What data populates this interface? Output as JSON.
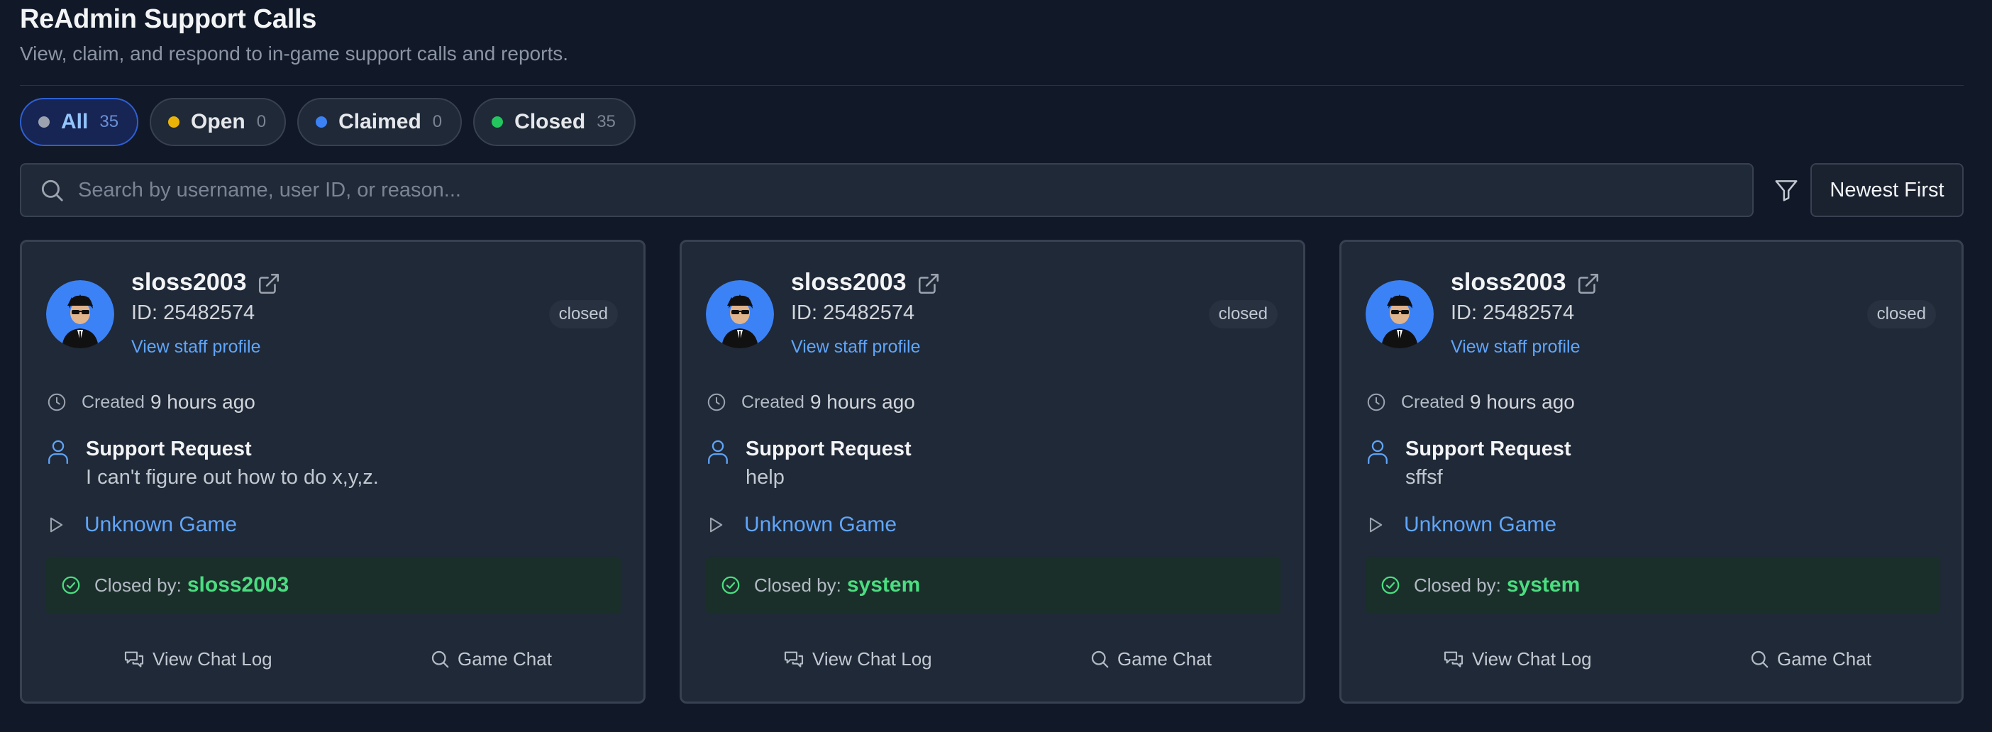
{
  "header": {
    "title": "ReAdmin Support Calls",
    "subtitle": "View, claim, and respond to in-game support calls and reports."
  },
  "tabs": [
    {
      "label": "All",
      "count": "35",
      "color": "#9ca3af",
      "active": true
    },
    {
      "label": "Open",
      "count": "0",
      "color": "#eab308",
      "active": false
    },
    {
      "label": "Claimed",
      "count": "0",
      "color": "#3b82f6",
      "active": false
    },
    {
      "label": "Closed",
      "count": "35",
      "color": "#22c55e",
      "active": false
    }
  ],
  "search": {
    "placeholder": "Search by username, user ID, or reason...",
    "value": ""
  },
  "sort": {
    "label": "Newest First"
  },
  "cards": [
    {
      "username": "sloss2003",
      "user_id": "ID: 25482574",
      "profile_link": "View staff profile",
      "status": "closed",
      "created_label": "Created",
      "created_value": "9 hours ago",
      "request_title": "Support Request",
      "reason": "I can't figure out how to do x,y,z.",
      "game": "Unknown Game",
      "closed_label": "Closed by:",
      "closed_by": "sloss2003",
      "chat_log_label": "View Chat Log",
      "game_chat_label": "Game Chat"
    },
    {
      "username": "sloss2003",
      "user_id": "ID: 25482574",
      "profile_link": "View staff profile",
      "status": "closed",
      "created_label": "Created",
      "created_value": "9 hours ago",
      "request_title": "Support Request",
      "reason": "help",
      "game": "Unknown Game",
      "closed_label": "Closed by:",
      "closed_by": "system",
      "chat_log_label": "View Chat Log",
      "game_chat_label": "Game Chat"
    },
    {
      "username": "sloss2003",
      "user_id": "ID: 25482574",
      "profile_link": "View staff profile",
      "status": "closed",
      "created_label": "Created",
      "created_value": "9 hours ago",
      "request_title": "Support Request",
      "reason": "sffsf",
      "game": "Unknown Game",
      "closed_label": "Closed by:",
      "closed_by": "system",
      "chat_log_label": "View Chat Log",
      "game_chat_label": "Game Chat"
    }
  ],
  "colors": {
    "background": "#111827",
    "card": "#1f2937",
    "accent": "#60a5fa",
    "success": "#4ade80",
    "active_tab": "#172554"
  },
  "icons": {
    "search": "search-icon",
    "filter": "filter-icon",
    "external_link": "external-link-icon",
    "clock": "clock-icon",
    "user": "user-icon",
    "play": "play-icon",
    "check": "check-circle-icon",
    "chat": "chat-bubbles-icon",
    "game_chat": "search-icon"
  }
}
